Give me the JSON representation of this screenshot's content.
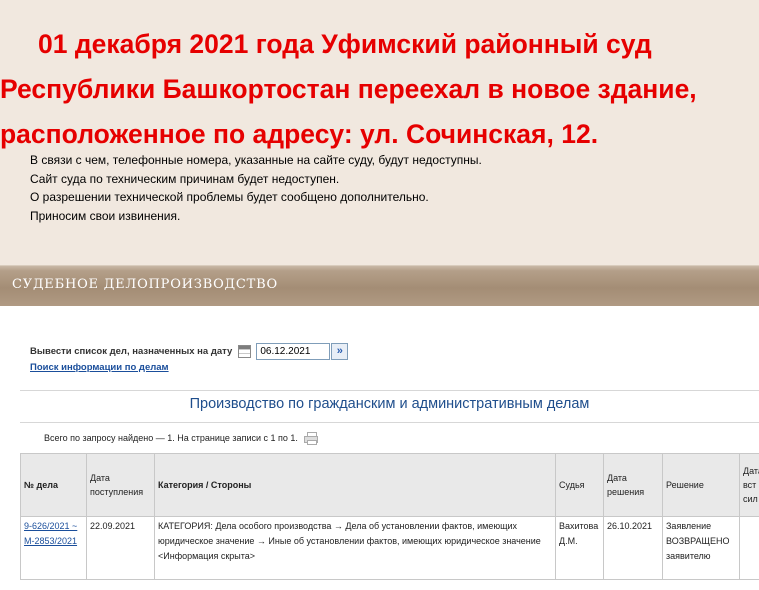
{
  "notice": {
    "title_lines": [
      " 01 декабря 2021 года Уфимский районный суд",
      "Республики Башкортостан переехал в новое здание,",
      "расположенное по адресу: ул. Сочинская, 12."
    ],
    "text_lines": [
      " В связи с чем, телефонные номера, указанные на сайте суду, будут недоступны.",
      "Сайт суда по техническим причинам будет недоступен.",
      "О разрешении технической проблемы будет сообщено дополнительно.",
      "Приносим свои извинения."
    ]
  },
  "section": {
    "title": "СУДЕБНОЕ ДЕЛОПРОИЗВОДСТВО"
  },
  "filter": {
    "date_label": "Вывести список дел, назначенных на дату",
    "date_value": "06.12.2021",
    "search_link": "Поиск информации по делам"
  },
  "table_title": "Производство по гражданским и административным делам",
  "count_text": "Всего по запросу найдено — 1. На странице записи с 1 по 1.",
  "table": {
    "headers": {
      "case_no": "№ дела",
      "received": "Дата поступления",
      "category": "Категория / Стороны",
      "judge": "Судья",
      "decision_date": "Дата решения",
      "decision": "Решение",
      "extra": "Дата вст в за сил"
    },
    "rows": [
      {
        "case_no": "9-626/2021 ~ М-2853/2021",
        "received": "22.09.2021",
        "category": "КАТЕГОРИЯ: Дела особого производства → Дела об установлении фактов, имеющих юридическое значение → Иные об установлении фактов, имеющих юридическое значение",
        "parties": "<Информация скрыта>",
        "judge": "Вахитова Д.М.",
        "decision_date": "26.10.2021",
        "decision": "Заявление ВОЗВРАЩЕНО заявителю",
        "extra": ""
      }
    ]
  },
  "colors": {
    "notice_bg": "#f1e8df",
    "notice_title": "#e60000",
    "section_bar": "#a48d75",
    "link": "#1a4e9b"
  },
  "icons": [
    "calendar-icon",
    "chevron-double-right-icon",
    "print-icon"
  ]
}
